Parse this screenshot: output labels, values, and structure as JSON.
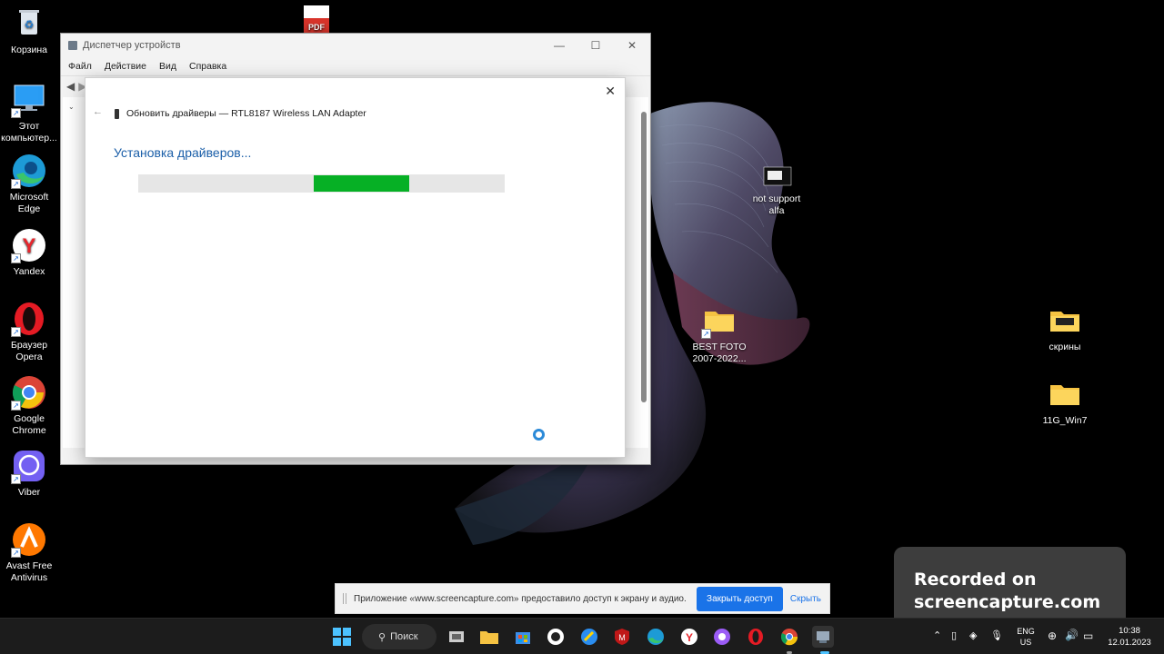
{
  "desktop": {
    "icons_left": [
      {
        "label": "Корзина"
      },
      {
        "label": "Этот компьютер..."
      },
      {
        "label": "Microsoft Edge"
      },
      {
        "label": "Yandex"
      },
      {
        "label": "Браузер Opera"
      },
      {
        "label": "Google Chrome"
      },
      {
        "label": "Viber"
      },
      {
        "label": "Avast Free Antivirus"
      }
    ],
    "pdf_icon_label": "PDF",
    "not_support": "not support alfa",
    "best_foto": "BEST FOTO 2007-2022...",
    "skriny": "скрины",
    "win7": "11G_Win7"
  },
  "device_manager": {
    "title": "Диспетчер устройств",
    "menu": [
      "Файл",
      "Действие",
      "Вид",
      "Справка"
    ]
  },
  "dialog": {
    "header": "Обновить драйверы — RTL8187 Wireless LAN Adapter",
    "heading": "Установка драйверов...",
    "progress": {
      "start": 0.48,
      "fraction": 0.26
    },
    "accent": "#06b025"
  },
  "recording_banner": {
    "line1": "Recorded on",
    "line2": "screencapture.com"
  },
  "share_bar": {
    "message": "Приложение «www.screencapture.com» предоставило доступ к экрану и аудио.",
    "stop_label": "Закрыть доступ",
    "hide_label": "Скрыть"
  },
  "taskbar": {
    "search_label": "Поиск",
    "lang": "ENG",
    "layout": "US",
    "time": "10:38",
    "date": "12.01.2023"
  }
}
